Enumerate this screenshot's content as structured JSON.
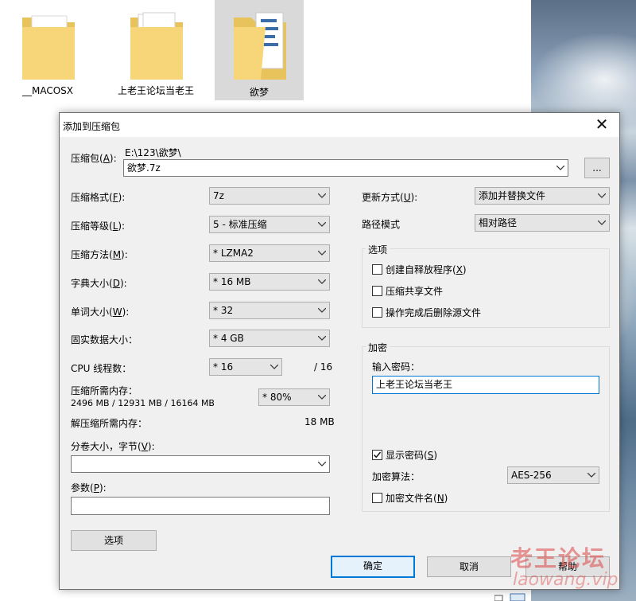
{
  "explorer": {
    "folders": [
      {
        "label": "__MACOSX",
        "selected": false
      },
      {
        "label": "上老王论坛当老王",
        "selected": false
      },
      {
        "label": "欲梦",
        "selected": true
      }
    ]
  },
  "dialog": {
    "title": "添加到压缩包",
    "close_glyph": "✕",
    "archive": {
      "label": "压缩包(",
      "label_key": "A",
      "label_end": "):",
      "path": "E:\\123\\欲梦\\",
      "filename": "欲梦.7z",
      "browse_label": "..."
    },
    "left": {
      "format": {
        "label": "压缩格式(",
        "key": "F",
        "end": "):",
        "value": "7z"
      },
      "level": {
        "label": "压缩等级(",
        "key": "L",
        "end": "):",
        "value": "5 - 标准压缩"
      },
      "method": {
        "label": "压缩方法(",
        "key": "M",
        "end": "):",
        "value": "* LZMA2"
      },
      "dict": {
        "label": "字典大小(",
        "key": "D",
        "end": "):",
        "value": "* 16 MB"
      },
      "word": {
        "label": "单词大小(",
        "key": "W",
        "end": "):",
        "value": "* 32"
      },
      "solid": {
        "label": "固实数据大小：",
        "value": "* 4 GB"
      },
      "cpu": {
        "label": "CPU 线程数：",
        "value": "* 16",
        "max": "/ 16"
      },
      "mem_compress": {
        "label": "压缩所需内存：",
        "detail": "2496 MB / 12931 MB / 16164 MB",
        "value": "* 80%"
      },
      "mem_decompress": {
        "label": "解压缩所需内存：",
        "value": "18 MB"
      },
      "volume": {
        "label": "分卷大小，字节(",
        "key": "V",
        "end": "):",
        "value": ""
      },
      "params": {
        "label": "参数(",
        "key": "P",
        "end": "):",
        "value": ""
      },
      "options_button": "选项"
    },
    "right": {
      "update": {
        "label": "更新方式(",
        "key": "U",
        "end": "):",
        "value": "添加并替换文件"
      },
      "path_mode": {
        "label": "路径模式",
        "value": "相对路径"
      },
      "options_group": {
        "title": "选项",
        "sfx": {
          "label": "创建自释放程序(",
          "key": "X",
          "end": ")",
          "checked": false
        },
        "shared": {
          "label": "压缩共享文件",
          "checked": false
        },
        "delete": {
          "label": "操作完成后删除源文件",
          "checked": false
        }
      },
      "encryption": {
        "title": "加密",
        "password_label": "输入密码：",
        "password_value": "上老王论坛当老王",
        "show_password": {
          "label": "显示密码(",
          "key": "S",
          "end": ")",
          "checked": true
        },
        "method_label": "加密算法：",
        "method_value": "AES-256",
        "encrypt_names": {
          "label": "加密文件名(",
          "key": "N",
          "end": ")",
          "checked": false
        }
      }
    },
    "buttons": {
      "ok": "确定",
      "cancel": "取消",
      "help": "帮助"
    }
  },
  "watermark": {
    "cn": "老王论坛",
    "en": "laowang.vip"
  },
  "colors": {
    "accent": "#0078d7",
    "dialog_bg": "#f0f0f0",
    "selected_folder": "#d9d9d9"
  }
}
